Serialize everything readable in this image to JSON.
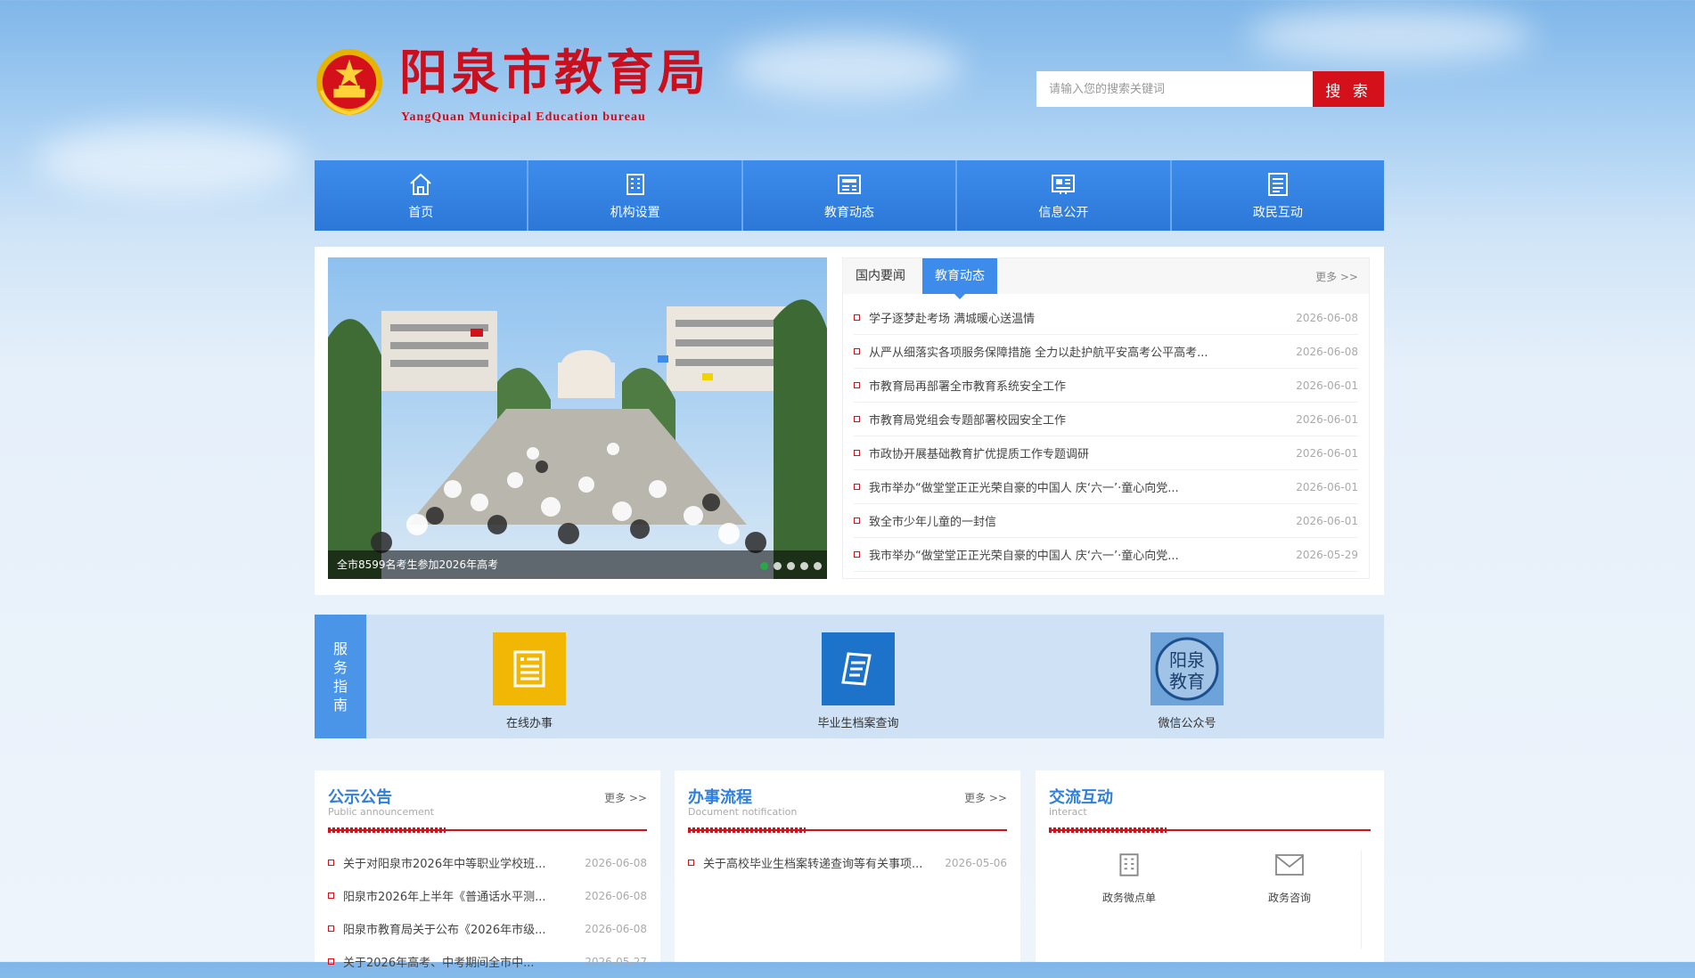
{
  "header": {
    "title": "阳泉市教育局",
    "subtitle": "YangQuan Municipal Education bureau"
  },
  "search": {
    "placeholder": "请输入您的搜索关键词",
    "button_label": "搜 索"
  },
  "nav": {
    "items": [
      {
        "label": "首页",
        "icon": "home-icon"
      },
      {
        "label": "机构设置",
        "icon": "building-icon"
      },
      {
        "label": "教育动态",
        "icon": "news-icon"
      },
      {
        "label": "信息公开",
        "icon": "info-board-icon"
      },
      {
        "label": "政民互动",
        "icon": "list-icon"
      }
    ]
  },
  "slider": {
    "caption": "全市8599名考生参加2026年高考",
    "slide_count": 5,
    "active_slide": 1
  },
  "news": {
    "tabs": [
      {
        "label": "国内要闻"
      },
      {
        "label": "教育动态"
      }
    ],
    "active_tab": "教育动态",
    "more_label": "更多 >>",
    "items": [
      {
        "title": "学子逐梦赴考场 满城暖心送温情",
        "date": "2026-06-08"
      },
      {
        "title": "从严从细落实各项服务保障措施 全力以赴护航平安高考公平高考...",
        "date": "2026-06-08"
      },
      {
        "title": "市教育局再部署全市教育系统安全工作",
        "date": "2026-06-01"
      },
      {
        "title": "市教育局党组会专题部署校园安全工作",
        "date": "2026-06-01"
      },
      {
        "title": "市政协开展基础教育扩优提质工作专题调研",
        "date": "2026-06-01"
      },
      {
        "title": "我市举办“做堂堂正正光荣自豪的中国人 庆‘六一’·童心向党...",
        "date": "2026-06-01"
      },
      {
        "title": "致全市少年儿童的一封信",
        "date": "2026-06-01"
      },
      {
        "title": "我市举办“做堂堂正正光荣自豪的中国人 庆‘六一’·童心向党...",
        "date": "2026-05-29"
      }
    ]
  },
  "service_guide": {
    "label": "服务指南",
    "label_chars": [
      "服",
      "务",
      "指",
      "南"
    ],
    "items": [
      {
        "label": "在线办事",
        "icon": "online-service-icon",
        "color": "#f2b705"
      },
      {
        "label": "毕业生档案查询",
        "icon": "archive-query-icon",
        "color": "#1d73c9"
      },
      {
        "label": "微信公众号",
        "icon": "wechat-account-icon",
        "icon_text": "阳泉教育",
        "color": "#2d6fb8"
      }
    ]
  },
  "columns": {
    "announcements": {
      "title": "公示公告",
      "subtitle": "Public announcement",
      "more_label": "更多 >>",
      "items": [
        {
          "title": "关于对阳泉市2026年中等职业学校班...",
          "date": "2026-06-08"
        },
        {
          "title": "阳泉市2026年上半年《普通话水平测...",
          "date": "2026-06-08"
        },
        {
          "title": "阳泉市教育局关于公布《2026年市级...",
          "date": "2026-06-08"
        },
        {
          "title": "关于2026年高考、中考期间全市中...",
          "date": "2026-05-27"
        }
      ]
    },
    "procedures": {
      "title": "办事流程",
      "subtitle": "Document notification",
      "more_label": "更多 >>",
      "items": [
        {
          "title": "关于高校毕业生档案转递查询等有关事项...",
          "date": "2026-05-06"
        }
      ]
    },
    "interaction": {
      "title": "交流互动",
      "subtitle": "interact",
      "items": [
        {
          "label": "政务微点单",
          "icon": "building-icon"
        },
        {
          "label": "政务咨询",
          "icon": "mail-icon"
        }
      ]
    }
  },
  "colors": {
    "brand_red": "#d4111b",
    "nav_blue": "#3d8ceb",
    "title_blue": "#2f7fdc"
  }
}
